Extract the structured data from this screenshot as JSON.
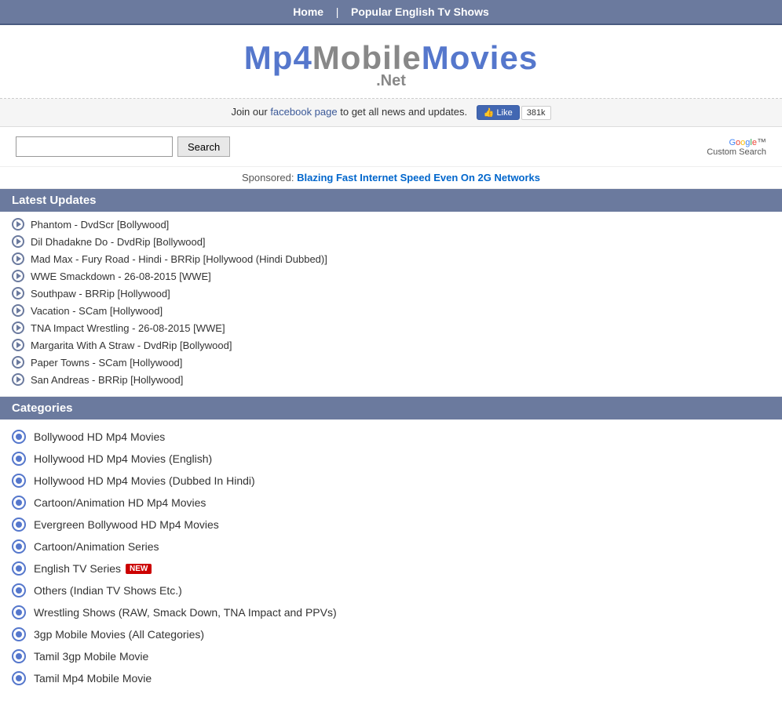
{
  "topnav": {
    "home_label": "Home",
    "separator": "|",
    "popular_label": "Popular English Tv Shows"
  },
  "logo": {
    "part1": "Mp4",
    "part2": "Mobile",
    "part3": "Movies",
    "sub": ".Net"
  },
  "fb_bar": {
    "text_before": "Join our",
    "link_text": "facebook page",
    "text_after": "to get all news and updates.",
    "like_label": "Like",
    "count": "381k"
  },
  "search": {
    "placeholder": "",
    "button_label": "Search",
    "google_line1": "Google",
    "google_line2": "Custom Search"
  },
  "sponsored": {
    "label": "Sponsored:",
    "link_text": "Blazing Fast Internet Speed Even On 2G Networks"
  },
  "latest_updates": {
    "header": "Latest Updates",
    "items": [
      {
        "label": "Phantom - DvdScr [Bollywood]"
      },
      {
        "label": "Dil Dhadakne Do - DvdRip [Bollywood]"
      },
      {
        "label": "Mad Max - Fury Road - Hindi - BRRip [Hollywood (Hindi Dubbed)]"
      },
      {
        "label": "WWE Smackdown - 26-08-2015 [WWE]"
      },
      {
        "label": "Southpaw - BRRip [Hollywood]"
      },
      {
        "label": "Vacation - SCam [Hollywood]"
      },
      {
        "label": "TNA Impact Wrestling - 26-08-2015 [WWE]"
      },
      {
        "label": "Margarita With A Straw - DvdRip [Bollywood]"
      },
      {
        "label": "Paper Towns - SCam [Hollywood]"
      },
      {
        "label": "San Andreas - BRRip [Hollywood]"
      }
    ]
  },
  "categories": {
    "header": "Categories",
    "items": [
      {
        "label": "Bollywood HD Mp4 Movies",
        "new": false
      },
      {
        "label": "Hollywood HD Mp4 Movies (English)",
        "new": false
      },
      {
        "label": "Hollywood HD Mp4 Movies (Dubbed In Hindi)",
        "new": false
      },
      {
        "label": "Cartoon/Animation HD Mp4 Movies",
        "new": false
      },
      {
        "label": "Evergreen Bollywood HD Mp4 Movies",
        "new": false
      },
      {
        "label": "Cartoon/Animation Series",
        "new": false
      },
      {
        "label": "English TV Series",
        "new": true
      },
      {
        "label": "Others (Indian TV Shows Etc.)",
        "new": false
      },
      {
        "label": "Wrestling Shows (RAW, Smack Down, TNA Impact and PPVs)",
        "new": false
      },
      {
        "label": "3gp Mobile Movies (All Categories)",
        "new": false
      },
      {
        "label": "Tamil 3gp Mobile Movie",
        "new": false
      },
      {
        "label": "Tamil Mp4 Mobile Movie",
        "new": false
      }
    ],
    "new_badge": "NEW"
  }
}
